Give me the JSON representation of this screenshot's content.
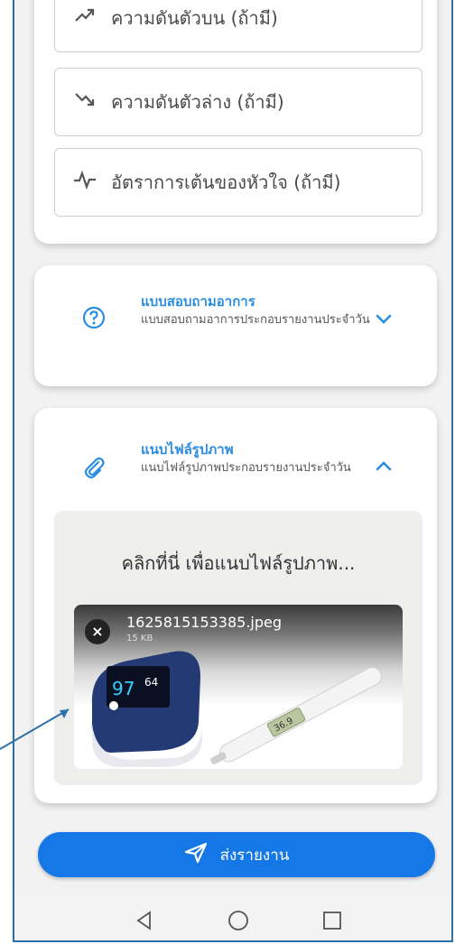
{
  "vitals": {
    "systolic_label": "ความดันตัวบน (ถ้ามี)",
    "diastolic_label": "ความดันตัวล่าง (ถ้ามี)",
    "heart_rate_label": "อัตราการเต้นของหัวใจ (ถ้ามี)"
  },
  "questionnaire": {
    "title": "แบบสอบถามอาการ",
    "subtitle": "แบบสอบถามอาการประกอบรายงานประจำวัน"
  },
  "attachment": {
    "title": "แนบไฟล์รูปภาพ",
    "subtitle": "แนบไฟล์รูปภาพประกอบรายงานประจำวัน",
    "upload_prompt": "คลิกที่นี่ เพื่อแนบไฟล์รูปภาพ...",
    "file": {
      "name": "1625815153385.jpeg",
      "size": "15 KB",
      "remove_symbol": "×",
      "oximeter_reading": "97",
      "oximeter_pulse": "64",
      "thermometer_reading": "36.9"
    }
  },
  "submit": {
    "label": "ส่งรายงาน"
  },
  "colors": {
    "accent": "#2b8de0",
    "button": "#1677e6",
    "annotation": "#2f6fa8"
  },
  "icons": {
    "systolic": "trend-up-icon",
    "diastolic": "trend-down-icon",
    "heart_rate": "pulse-icon",
    "questionnaire": "question-circle-icon",
    "attachment": "paperclip-icon",
    "send": "send-icon"
  }
}
